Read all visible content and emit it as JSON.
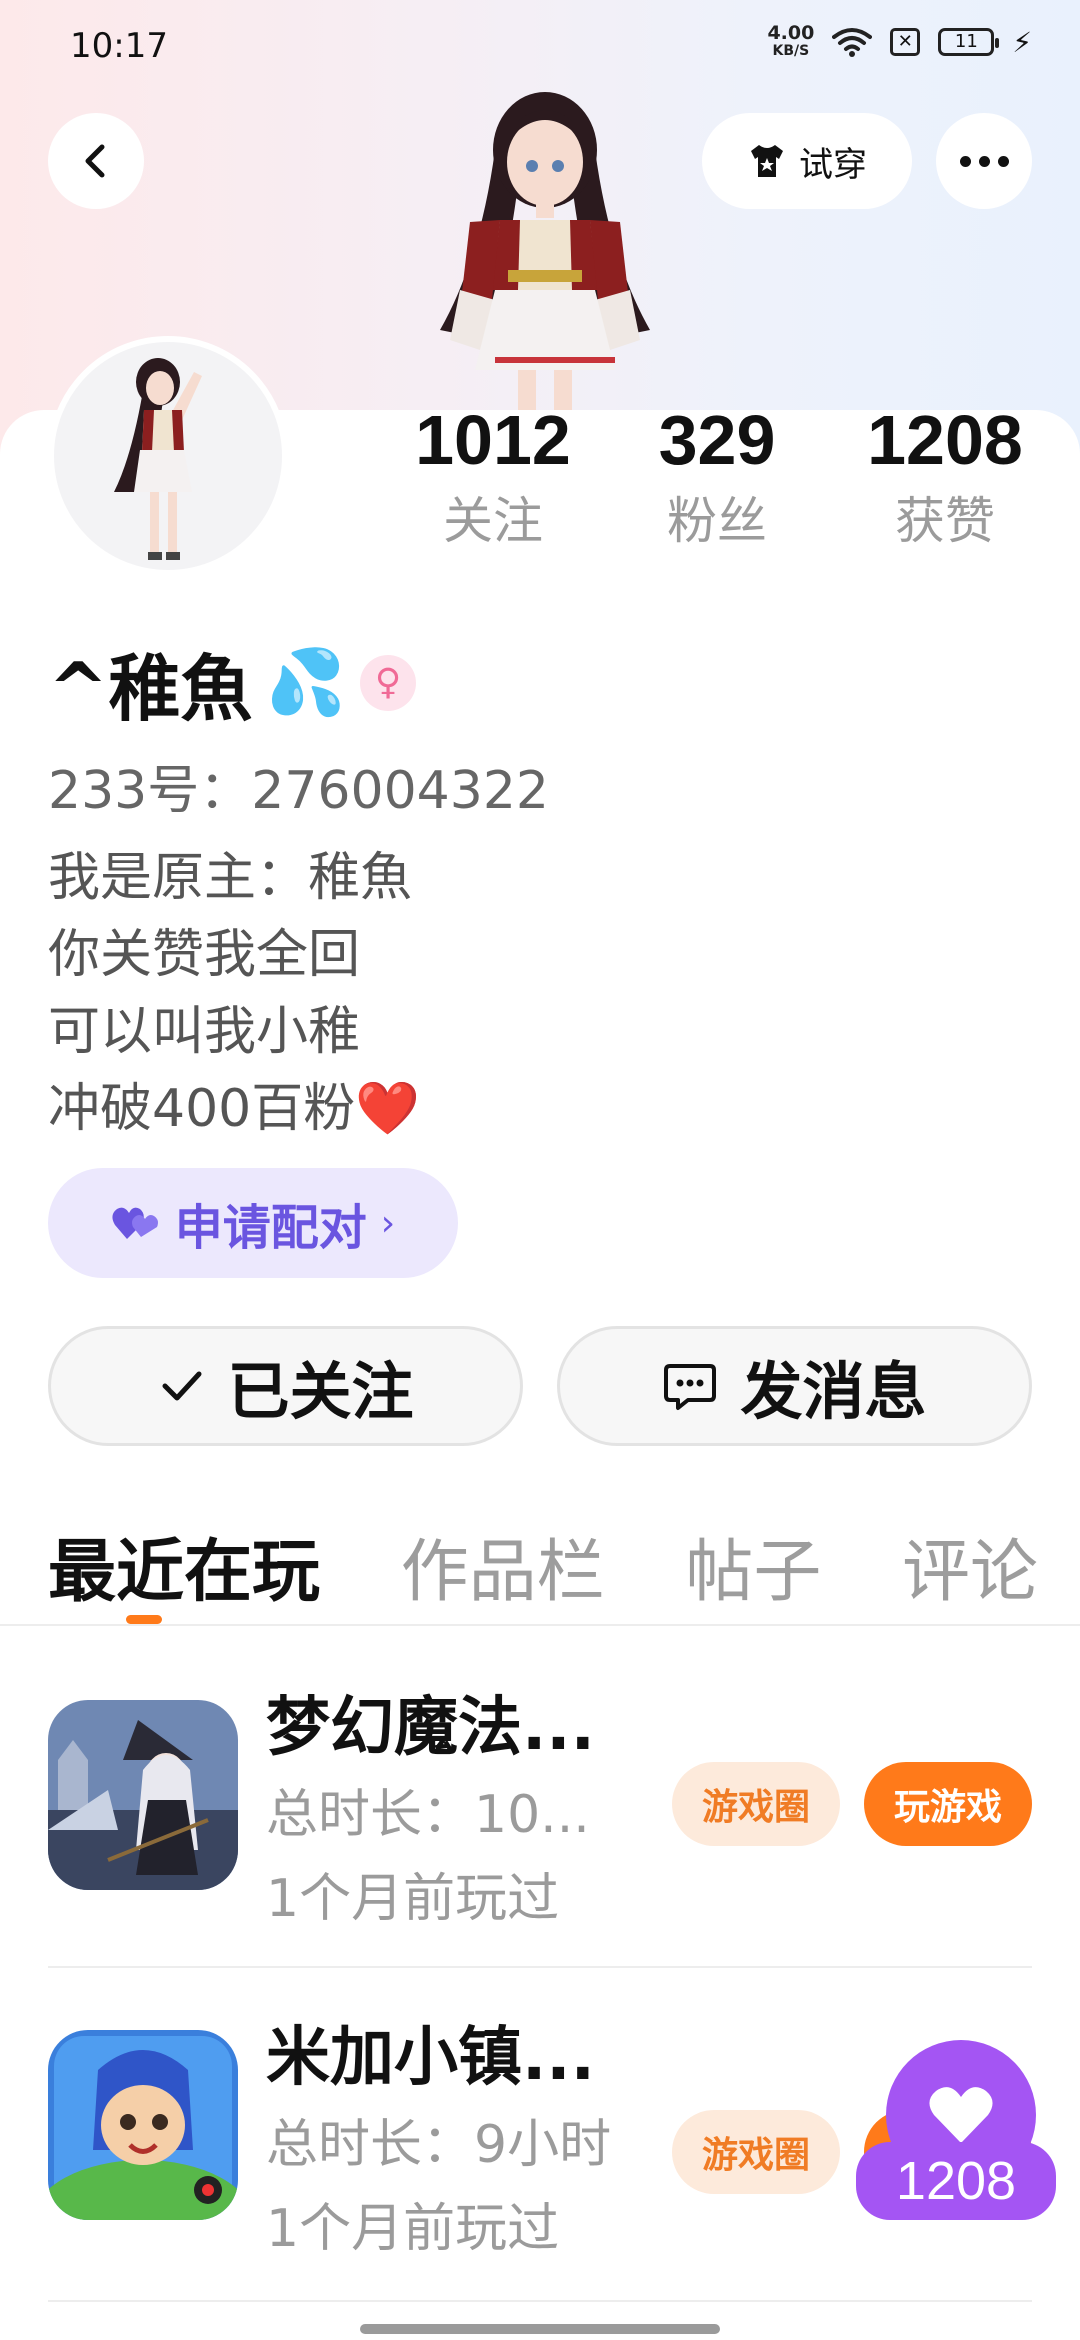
{
  "status_bar": {
    "time": "10:17",
    "net_speed_value": "4.00",
    "net_speed_unit": "KB/S",
    "battery": "11"
  },
  "top_bar": {
    "tryon_label": "试穿"
  },
  "profile": {
    "stats": [
      {
        "value": "1012",
        "label": "关注"
      },
      {
        "value": "329",
        "label": "粉丝"
      },
      {
        "value": "1208",
        "label": "获赞"
      }
    ],
    "name": "^稚魚",
    "name_emoji": "💦",
    "gender_symbol": "♀",
    "uid": "233号：276004322",
    "bio": [
      "我是原主：稚魚",
      "你关赞我全回",
      "可以叫我小稚",
      "冲破400百粉❤️"
    ],
    "pair_label": "申请配对",
    "pair_chevron": "›",
    "follow_label": "已关注",
    "message_label": "发消息"
  },
  "tabs": [
    "最近在玩",
    "作品栏",
    "帖子",
    "评论"
  ],
  "games": [
    {
      "title": "梦幻魔法...",
      "duration": "总时长：10...",
      "last_played": "1个月前玩过",
      "circle_label": "游戏圈",
      "play_label": "玩游戏"
    },
    {
      "title": "米加小镇...",
      "duration": "总时长：9小时",
      "last_played": "1个月前玩过",
      "circle_label": "游戏圈"
    }
  ],
  "like_float": {
    "count": "1208"
  },
  "colors": {
    "accent_orange": "#ff7a1a",
    "pair_purple": "#6a55e0",
    "like_purple": "#a455f3"
  }
}
